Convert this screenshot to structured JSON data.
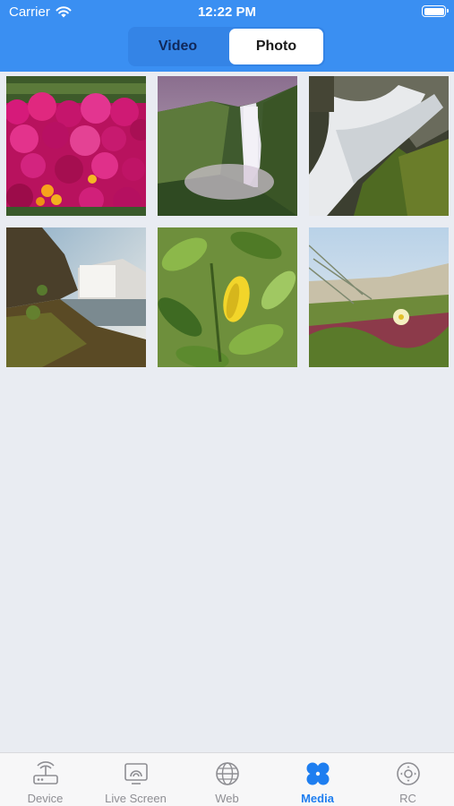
{
  "status_bar": {
    "carrier": "Carrier",
    "time": "12:22 PM"
  },
  "segmented": {
    "video_label": "Video",
    "photo_label": "Photo",
    "selected": "Photo"
  },
  "photos": [
    {
      "subject": "pink-flowers"
    },
    {
      "subject": "waterfall-valley"
    },
    {
      "subject": "waterfall-closeup"
    },
    {
      "subject": "coastal-waterfall"
    },
    {
      "subject": "green-leaves"
    },
    {
      "subject": "coastal-flower"
    }
  ],
  "tabbar": {
    "items": [
      {
        "label": "Device",
        "icon": "router-icon"
      },
      {
        "label": "Live Screen",
        "icon": "cast-icon"
      },
      {
        "label": "Web",
        "icon": "globe-icon"
      },
      {
        "label": "Media",
        "icon": "media-icon"
      },
      {
        "label": "RC",
        "icon": "remote-icon"
      }
    ],
    "active": "Media"
  },
  "colors": {
    "accent": "#3a8ff2",
    "active_tab": "#1e7ef0",
    "inactive_tab": "#8e8e93",
    "background": "#e9ecf2"
  }
}
